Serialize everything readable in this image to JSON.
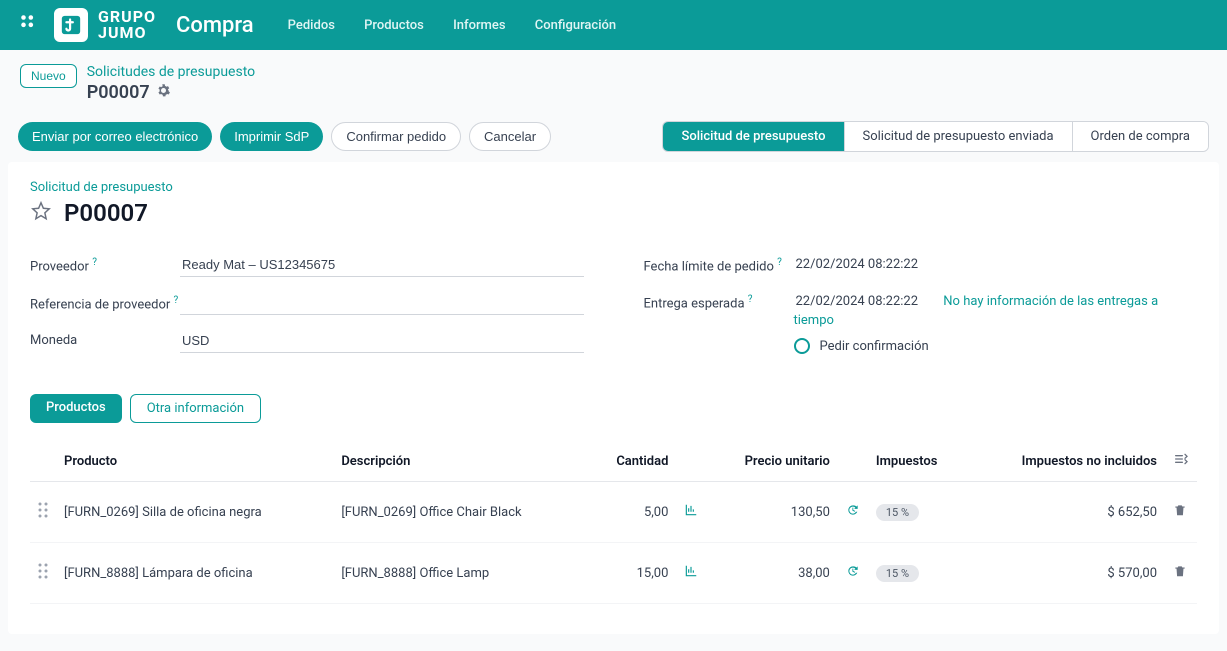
{
  "topbar": {
    "logo_text_1": "GRUPO",
    "logo_text_2": "JUMO",
    "module": "Compra",
    "menu": [
      "Pedidos",
      "Productos",
      "Informes",
      "Configuración"
    ]
  },
  "header": {
    "new_button": "Nuevo",
    "breadcrumb_parent": "Solicitudes de presupuesto",
    "breadcrumb_current": "P00007"
  },
  "actions": {
    "send_email": "Enviar por correo electrónico",
    "print": "Imprimir SdP",
    "confirm": "Confirmar pedido",
    "cancel": "Cancelar"
  },
  "status": {
    "stages": [
      "Solicitud de presupuesto",
      "Solicitud de presupuesto enviada",
      "Orden de compra"
    ],
    "active_index": 0
  },
  "form": {
    "title_small": "Solicitud de presupuesto",
    "title": "P00007",
    "left": {
      "vendor_label": "Proveedor",
      "vendor_value": "Ready Mat – US12345675",
      "vendor_ref_label": "Referencia de proveedor",
      "vendor_ref_value": "",
      "currency_label": "Moneda",
      "currency_value": "USD"
    },
    "right": {
      "deadline_label": "Fecha límite de pedido",
      "deadline_value": "22/02/2024 08:22:22",
      "expected_label": "Entrega esperada",
      "expected_value": "22/02/2024 08:22:22",
      "expected_link": "No hay información de las entregas a tiempo",
      "ask_confirm": "Pedir confirmación"
    }
  },
  "tabs": {
    "products": "Productos",
    "other": "Otra información",
    "active": 0
  },
  "table": {
    "headers": {
      "product": "Producto",
      "description": "Descripción",
      "qty": "Cantidad",
      "unit_price": "Precio unitario",
      "taxes": "Impuestos",
      "subtotal": "Impuestos no incluidos"
    },
    "rows": [
      {
        "product": "[FURN_0269] Silla de oficina negra",
        "description": "[FURN_0269] Office Chair Black",
        "qty": "5,00",
        "unit_price": "130,50",
        "tax": "15 %",
        "subtotal": "$ 652,50"
      },
      {
        "product": "[FURN_8888] Lámpara de oficina",
        "description": "[FURN_8888] Office Lamp",
        "qty": "15,00",
        "unit_price": "38,00",
        "tax": "15 %",
        "subtotal": "$ 570,00"
      }
    ]
  }
}
